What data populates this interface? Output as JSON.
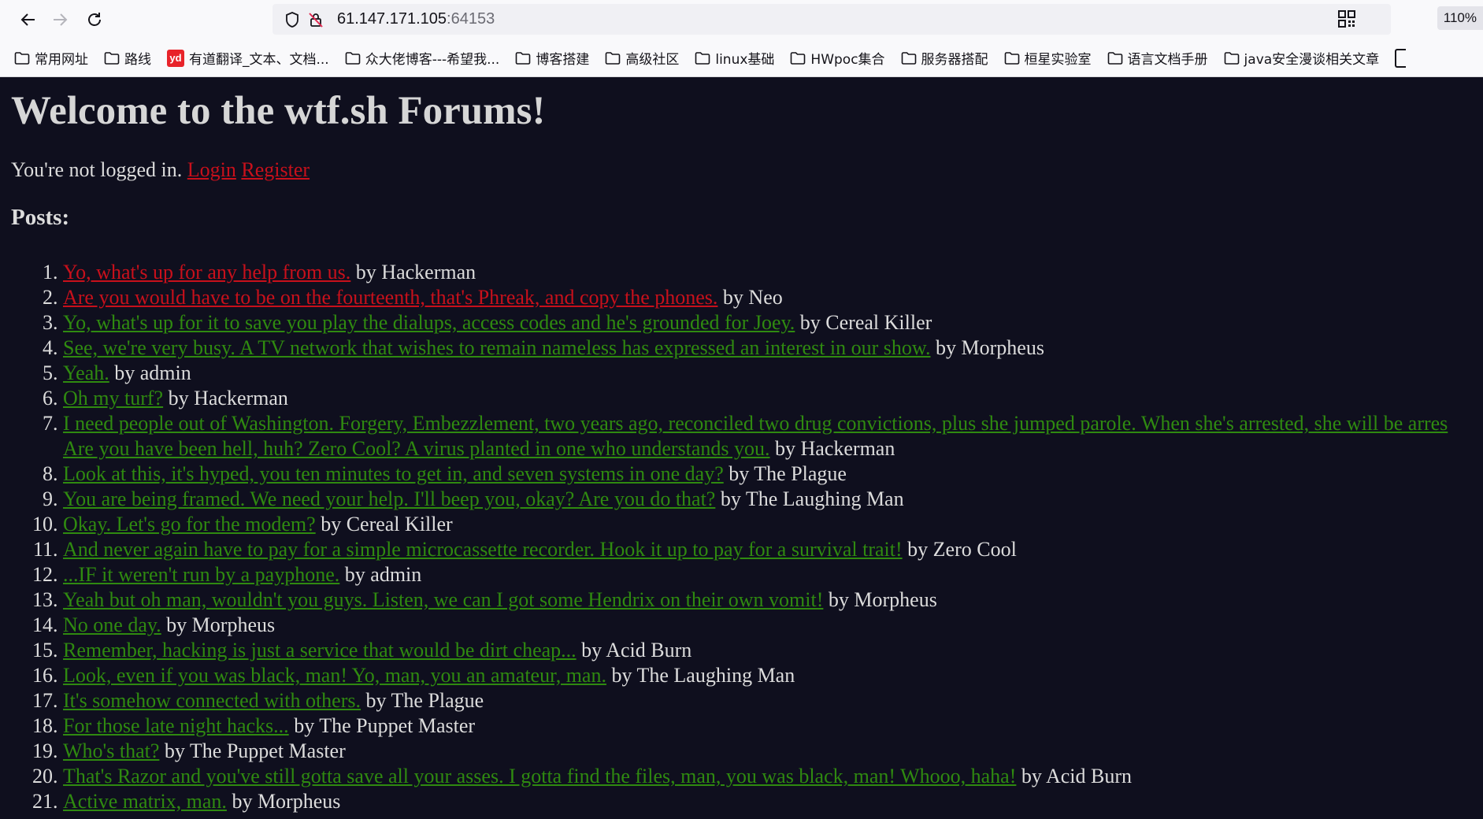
{
  "browser": {
    "url_host": "61.147.171.105",
    "url_port": ":64153",
    "zoom": "110%",
    "bookmarks": [
      {
        "label": "常用网址",
        "icon": "folder-icon"
      },
      {
        "label": "路线",
        "icon": "folder-icon"
      },
      {
        "label": "有道翻译_文本、文档...",
        "icon": "youdao-logo",
        "logo_text": "yd"
      },
      {
        "label": "众大佬博客---希望我...",
        "icon": "folder-icon"
      },
      {
        "label": "博客搭建",
        "icon": "folder-icon"
      },
      {
        "label": "高级社区",
        "icon": "folder-icon"
      },
      {
        "label": "linux基础",
        "icon": "folder-icon"
      },
      {
        "label": "HWpoc集合",
        "icon": "folder-icon"
      },
      {
        "label": "服务器搭配",
        "icon": "folder-icon"
      },
      {
        "label": "桓星实验室",
        "icon": "folder-icon"
      },
      {
        "label": "语言文档手册",
        "icon": "folder-icon"
      },
      {
        "label": "java安全漫谈相关文章",
        "icon": "folder-icon"
      }
    ]
  },
  "page": {
    "title": "Welcome to the wtf.sh Forums!",
    "status_text": "You're not logged in.",
    "login_label": "Login",
    "register_label": "Register",
    "posts_heading": "Posts:",
    "posts": [
      {
        "title": "Yo, what's up for any help from us.",
        "author": "Hackerman",
        "link_color": "#c8101b"
      },
      {
        "title": "Are you would have to be on the fourteenth, that's Phreak, and copy the phones.",
        "author": "Neo",
        "link_color": "#c8101b"
      },
      {
        "title": "Yo, what's up for it to save you play the dialups, access codes and he's grounded for Joey.",
        "author": "Cereal Killer",
        "link_color": "#2f8a10"
      },
      {
        "title": "See, we're very busy. A TV network that wishes to remain nameless has expressed an interest in our show.",
        "author": "Morpheus",
        "link_color": "#2f8a10"
      },
      {
        "title": "Yeah.",
        "author": "admin",
        "link_color": "#2f8a10"
      },
      {
        "title": "Oh my turf?",
        "author": "Hackerman",
        "link_color": "#2f8a10"
      },
      {
        "title": "I need people out of Washington. Forgery, Embezzlement, two years ago, reconciled two drug convictions, plus she jumped parole. When she's arrested, she will be arres",
        "title_cont": "Are you have been hell, huh? Zero Cool? A virus planted in one who understands you.",
        "author": "Hackerman",
        "link_color": "#2f8a10"
      },
      {
        "title": "Look at this, it's hyped, you ten minutes to get in, and seven systems in one day?",
        "author": "The Plague",
        "link_color": "#2f8a10"
      },
      {
        "title": "You are being framed. We need your help. I'll beep you, okay? Are you do that?",
        "author": "The Laughing Man",
        "link_color": "#2f8a10"
      },
      {
        "title": "Okay. Let's go for the modem?",
        "author": "Cereal Killer",
        "link_color": "#2f8a10"
      },
      {
        "title": "And never again have to pay for a simple microcassette recorder. Hook it up to pay for a survival trait!",
        "author": "Zero Cool",
        "link_color": "#2f8a10"
      },
      {
        "title": "...IF it weren't run by a payphone.",
        "author": "admin",
        "link_color": "#2f8a10"
      },
      {
        "title": "Yeah but oh man, wouldn't you guys. Listen, we can I got some Hendrix on their own vomit!",
        "author": "Morpheus",
        "link_color": "#2f8a10"
      },
      {
        "title": "No one day.",
        "author": "Morpheus",
        "link_color": "#2f8a10"
      },
      {
        "title": "Remember, hacking is just a service that would be dirt cheap...",
        "author": "Acid Burn",
        "link_color": "#2f8a10"
      },
      {
        "title": "Look, even if you was black, man! Yo, man, you an amateur, man.",
        "author": "The Laughing Man",
        "link_color": "#2f8a10"
      },
      {
        "title": "It's somehow connected with others.",
        "author": "The Plague",
        "link_color": "#2f8a10"
      },
      {
        "title": "For those late night hacks...",
        "author": "The Puppet Master",
        "link_color": "#2f8a10"
      },
      {
        "title": "Who's that?",
        "author": "The Puppet Master",
        "link_color": "#2f8a10"
      },
      {
        "title": "That's Razor and you've still gotta save all your asses. I gotta find the files, man, you was black, man! Whooo, haha!",
        "author": "Acid Burn",
        "link_color": "#2f8a10"
      },
      {
        "title": "Active matrix, man.",
        "author": "Morpheus",
        "link_color": "#2f8a10"
      }
    ]
  }
}
